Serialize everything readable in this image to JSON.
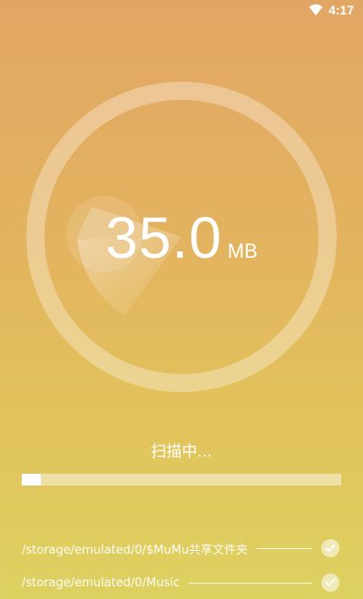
{
  "status_bar": {
    "time": "4:17",
    "wifi_icon": "wifi-icon"
  },
  "scan": {
    "size_value": "35.0",
    "size_unit": "MB",
    "status_text": "扫描中...",
    "progress_fraction": 0.06
  },
  "paths": [
    {
      "text": "/storage/emulated/0/$MuMu共享文件夹",
      "state_icon": "check-icon"
    },
    {
      "text": "/storage/emulated/0/Music",
      "state_icon": "check-icon"
    }
  ],
  "colors": {
    "background_top": "#e2a664",
    "background_bottom": "#dcd160",
    "foreground": "#ffffff"
  }
}
